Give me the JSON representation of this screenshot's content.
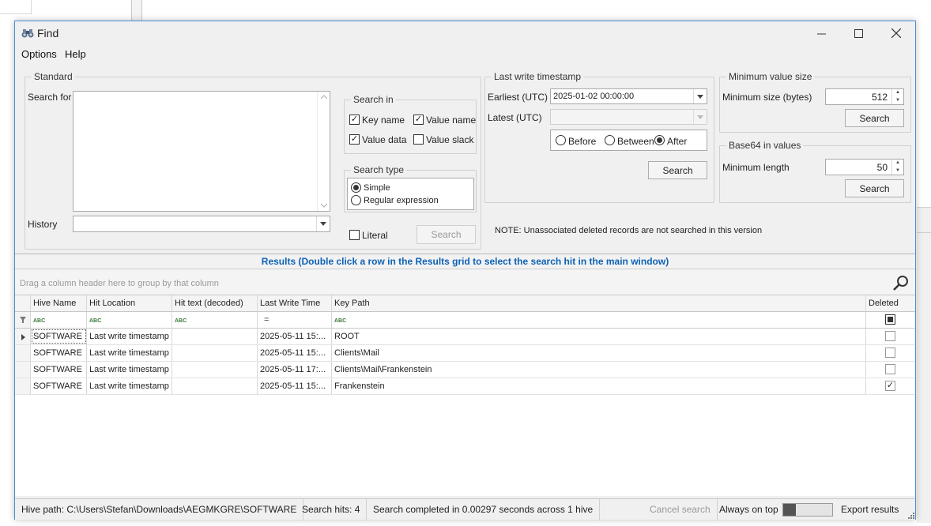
{
  "window": {
    "title": "Find"
  },
  "menu": [
    "Options",
    "Help"
  ],
  "standard": {
    "legend": "Standard",
    "search_for_label": "Search for",
    "search_for_value": "",
    "history_label": "History",
    "history_value": ""
  },
  "search_in": {
    "legend": "Search in",
    "key_name": "Key name",
    "value_name": "Value name",
    "value_data": "Value data",
    "value_slack": "Value slack",
    "key_name_checked": true,
    "value_name_checked": true,
    "value_data_checked": true,
    "value_slack_checked": false
  },
  "search_type": {
    "legend": "Search type",
    "simple": "Simple",
    "regex": "Regular expression",
    "selected": "simple"
  },
  "literal_label": "Literal",
  "search_button": "Search",
  "last_write": {
    "legend": "Last write timestamp",
    "earliest_label": "Earliest (UTC)",
    "earliest_value": "2025-01-02 00:00:00",
    "latest_label": "Latest (UTC)",
    "latest_value": "",
    "before": "Before",
    "between": "Between",
    "after": "After",
    "selected": "after",
    "search_button": "Search"
  },
  "min_value": {
    "legend": "Minimum value size",
    "label": "Minimum size (bytes)",
    "value": "512",
    "search_button": "Search"
  },
  "base64": {
    "legend": "Base64 in values",
    "label": "Minimum length",
    "value": "50",
    "search_button": "Search"
  },
  "note": "NOTE: Unassociated deleted records are not searched in this version",
  "results": {
    "header": "Results (Double click a row in the Results grid to select the search hit in the main window)",
    "group_hint": "Drag a column header here to group by that column",
    "columns": [
      "Hive Name",
      "Hit Location",
      "Hit text (decoded)",
      "Last Write Time",
      "Key Path",
      "Deleted"
    ],
    "filter_marks": [
      "ABC",
      "ABC",
      "ABC",
      "=",
      "ABC"
    ],
    "rows": [
      {
        "hive": "SOFTWARE",
        "location": "Last write timestamp",
        "text": "",
        "time": "2025-05-11 15:...",
        "path": "ROOT",
        "deleted": false
      },
      {
        "hive": "SOFTWARE",
        "location": "Last write timestamp",
        "text": "",
        "time": "2025-05-11 15:...",
        "path": "Clients\\Mail",
        "deleted": false
      },
      {
        "hive": "SOFTWARE",
        "location": "Last write timestamp",
        "text": "",
        "time": "2025-05-11 17:...",
        "path": "Clients\\Mail\\Frankenstein",
        "deleted": false
      },
      {
        "hive": "SOFTWARE",
        "location": "Last write timestamp",
        "text": "",
        "time": "2025-05-11 15:...",
        "path": "Frankenstein",
        "deleted": true
      }
    ]
  },
  "status": {
    "hive_path": "Hive path: C:\\Users\\Stefan\\Downloads\\AEGMKGRE\\SOFTWARE",
    "hits": "Search hits: 4",
    "completed": "Search completed in 0.00297 seconds across 1 hive",
    "cancel": "Cancel search",
    "always_on_top": "Always on top",
    "export": "Export results"
  }
}
